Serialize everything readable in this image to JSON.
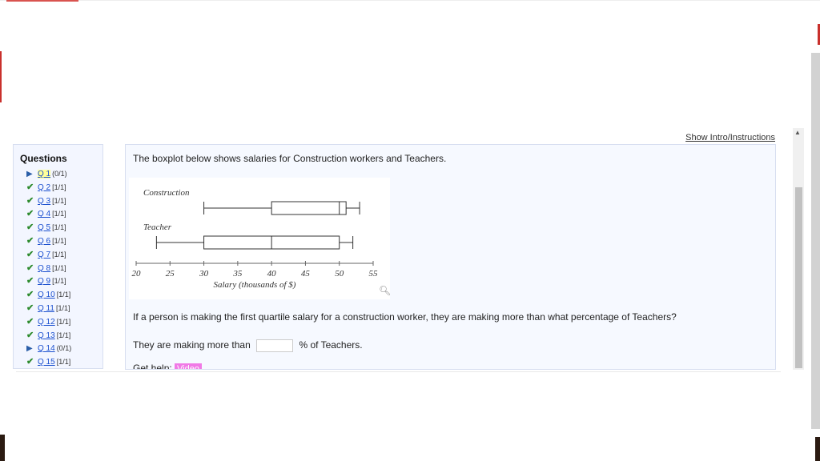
{
  "header": {
    "intro_link": "Show Intro/Instructions"
  },
  "sidebar": {
    "title": "Questions",
    "items": [
      {
        "label": "Q 1",
        "score": "(0/1)",
        "status": "current"
      },
      {
        "label": "Q 2",
        "score": "[1/1]",
        "status": "done"
      },
      {
        "label": "Q 3",
        "score": "[1/1]",
        "status": "done"
      },
      {
        "label": "Q 4",
        "score": "[1/1]",
        "status": "done"
      },
      {
        "label": "Q 5",
        "score": "[1/1]",
        "status": "done"
      },
      {
        "label": "Q 6",
        "score": "[1/1]",
        "status": "done"
      },
      {
        "label": "Q 7",
        "score": "[1/1]",
        "status": "done"
      },
      {
        "label": "Q 8",
        "score": "[1/1]",
        "status": "done"
      },
      {
        "label": "Q 9",
        "score": "[1/1]",
        "status": "done"
      },
      {
        "label": "Q 10",
        "score": "[1/1]",
        "status": "done"
      },
      {
        "label": "Q 11",
        "score": "[1/1]",
        "status": "done"
      },
      {
        "label": "Q 12",
        "score": "[1/1]",
        "status": "done"
      },
      {
        "label": "Q 13",
        "score": "[1/1]",
        "status": "done"
      },
      {
        "label": "Q 14",
        "score": "(0/1)",
        "status": "pending"
      },
      {
        "label": "Q 15",
        "score": "[1/1]",
        "status": "done"
      }
    ]
  },
  "question": {
    "intro": "The boxplot below shows salaries for Construction workers and Teachers.",
    "prompt": "If a person is making the first quartile salary for a construction worker, they are making more than what percentage of Teachers?",
    "answer_prefix": "They are making more than",
    "answer_value": "",
    "answer_suffix": "% of Teachers.",
    "help_label": "Get help:",
    "video_label": "Video"
  },
  "chart_data": {
    "type": "boxplot",
    "xlabel": "Salary (thousands of $)",
    "xlim": [
      20,
      55
    ],
    "xticks": [
      20,
      25,
      30,
      35,
      40,
      45,
      50,
      55
    ],
    "series": [
      {
        "name": "Construction",
        "min": 30,
        "q1": 40,
        "median": 50,
        "q3": 51,
        "max": 53
      },
      {
        "name": "Teacher",
        "min": 23,
        "q1": 30,
        "median": 40,
        "q3": 50,
        "max": 52
      }
    ]
  },
  "colors": {
    "done": "#2e8b2e",
    "current": "#2a5ea8",
    "link": "#1a4fcf",
    "video": "#f07ae6"
  }
}
